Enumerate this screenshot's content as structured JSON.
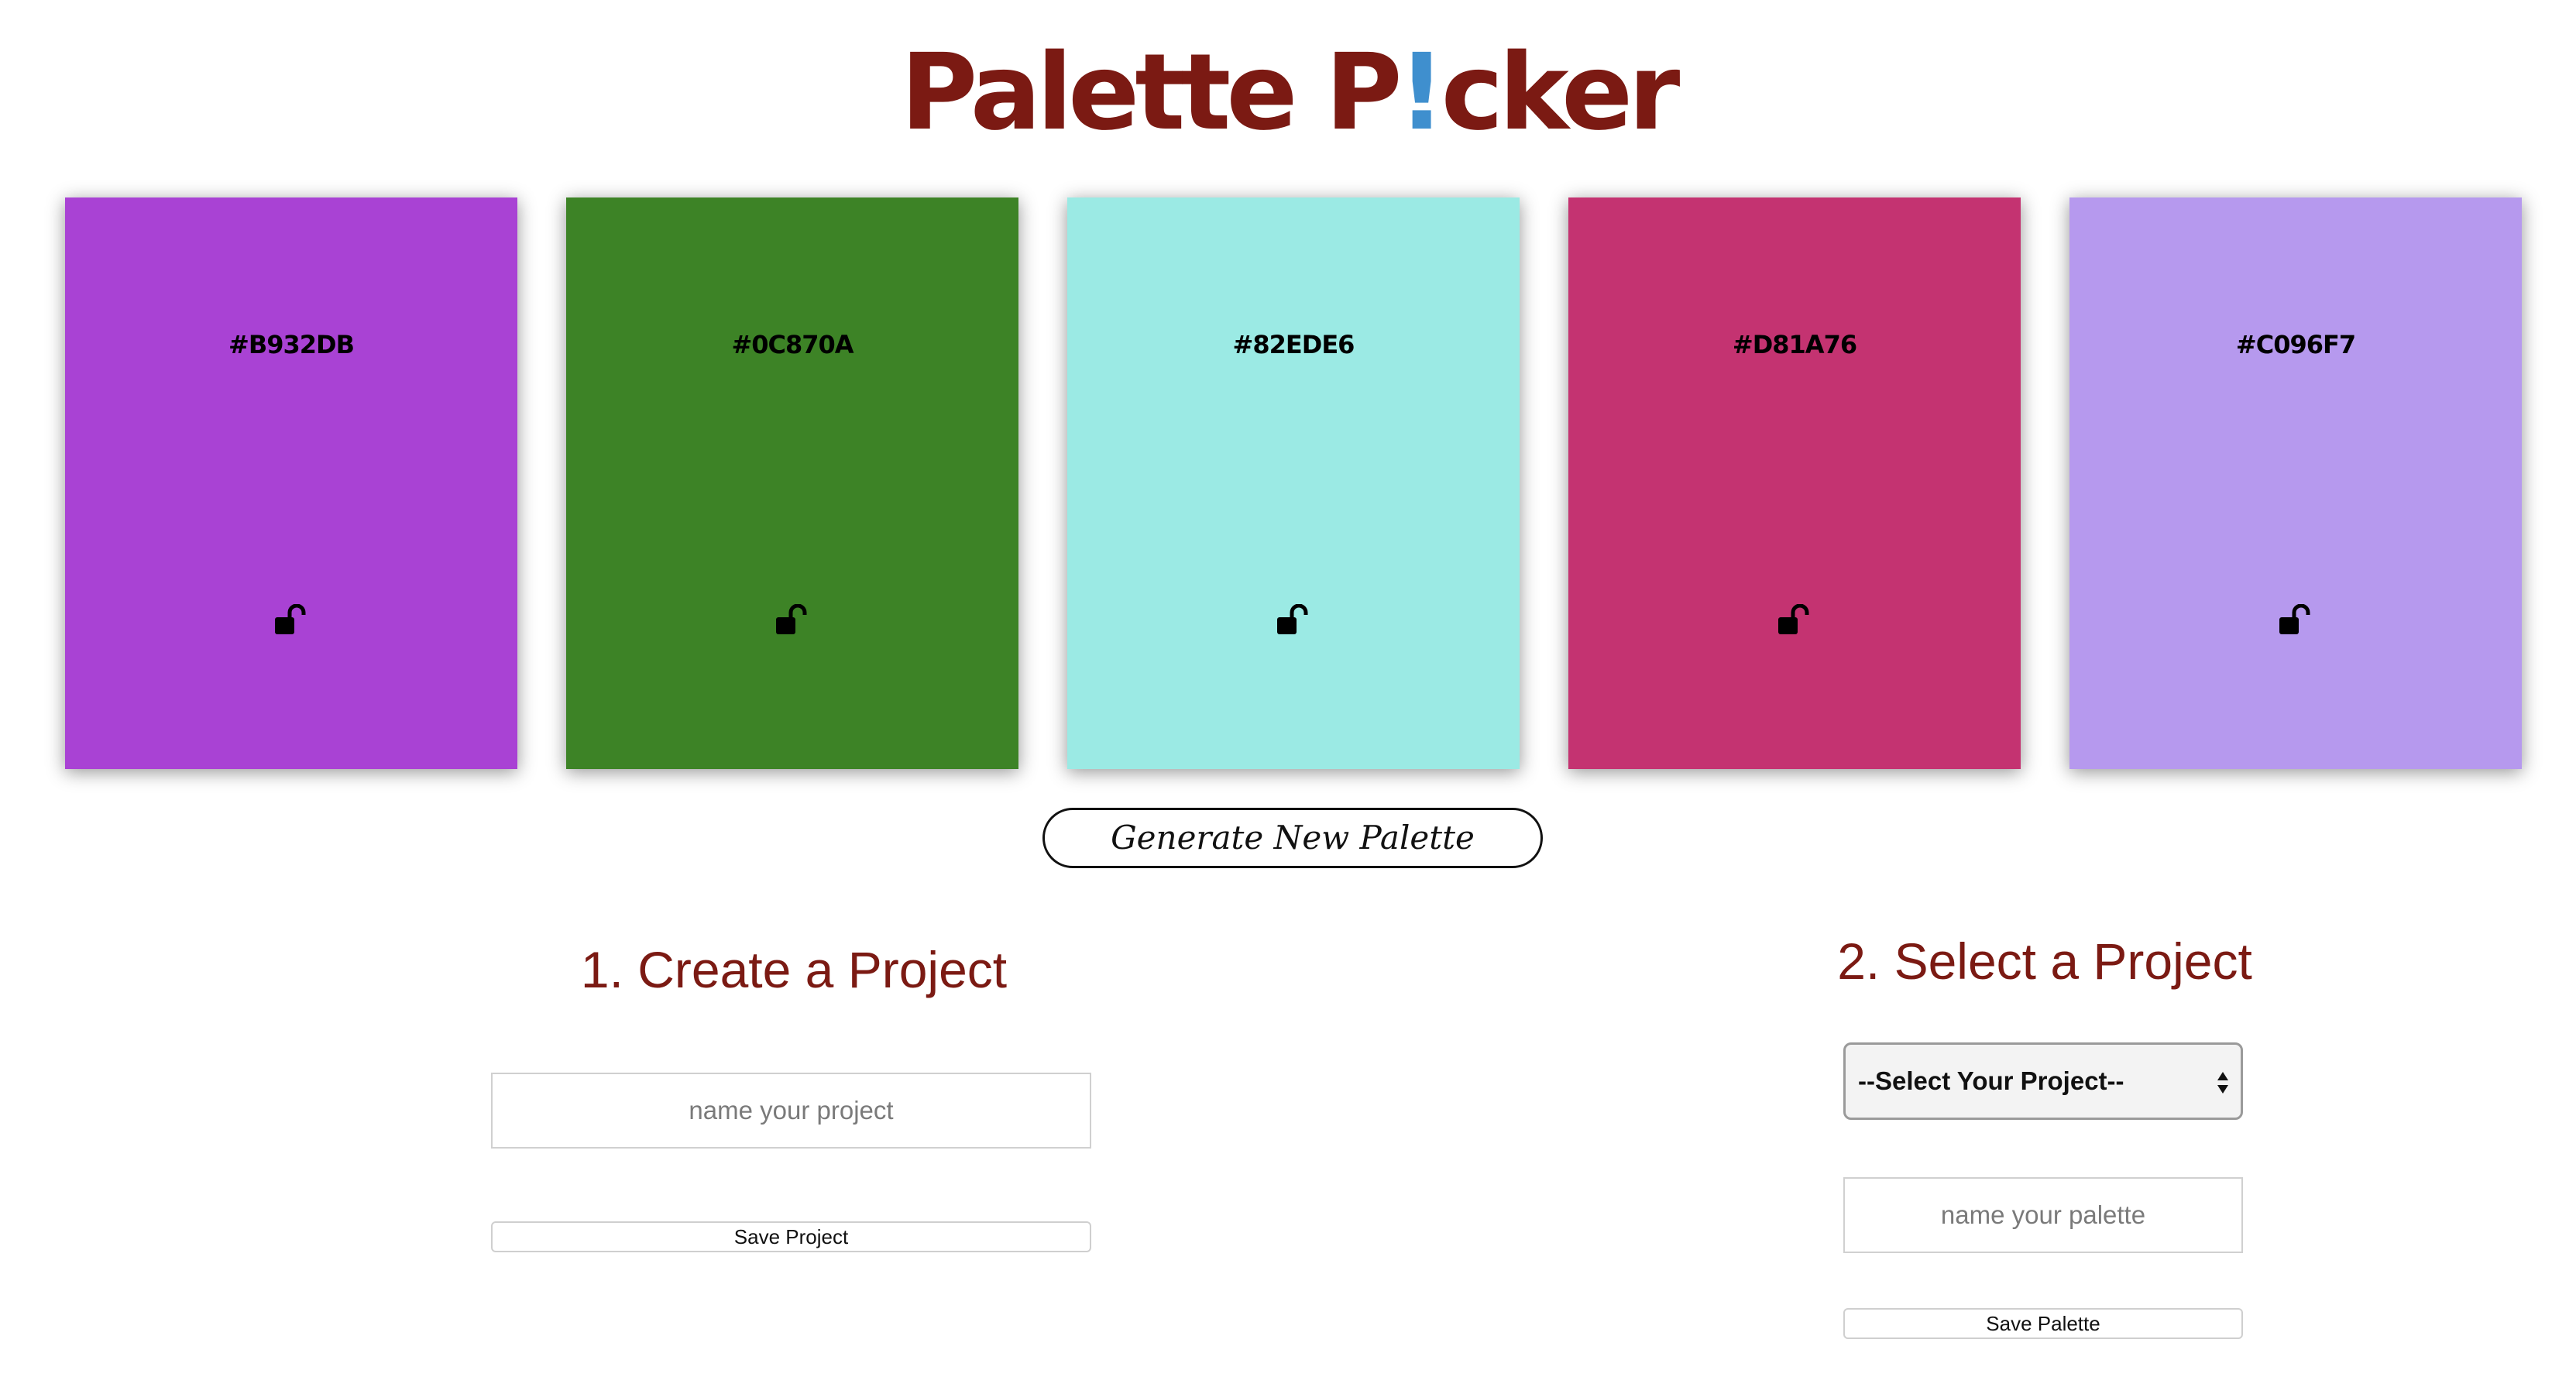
{
  "header": {
    "title_part1": "Palette P",
    "title_accent": "!",
    "title_part2": "cker",
    "title_color": "#7b1a13",
    "accent_color": "#3f8fce"
  },
  "palette": {
    "swatches": [
      {
        "hex": "#B932DB",
        "fill": "#a942d4",
        "locked": false,
        "lock_icon": "unlocked-padlock-icon"
      },
      {
        "hex": "#0C870A",
        "fill": "#3d8326",
        "locked": false,
        "lock_icon": "unlocked-padlock-icon"
      },
      {
        "hex": "#82EDE6",
        "fill": "#9beae4",
        "locked": false,
        "lock_icon": "unlocked-padlock-icon"
      },
      {
        "hex": "#D81A76",
        "fill": "#c43371",
        "locked": false,
        "lock_icon": "unlocked-padlock-icon"
      },
      {
        "hex": "#C096F7",
        "fill": "#b699ee",
        "locked": false,
        "lock_icon": "unlocked-padlock-icon"
      }
    ],
    "generate_label": "Generate New Palette"
  },
  "create_project": {
    "heading": "1. Create a Project",
    "input_value": "",
    "input_placeholder": "name your project",
    "save_label": "Save Project"
  },
  "select_project": {
    "heading": "2. Select a Project",
    "select_value": "--Select Your Project--",
    "palette_input_value": "",
    "palette_input_placeholder": "name your palette",
    "save_label": "Save Palette"
  }
}
